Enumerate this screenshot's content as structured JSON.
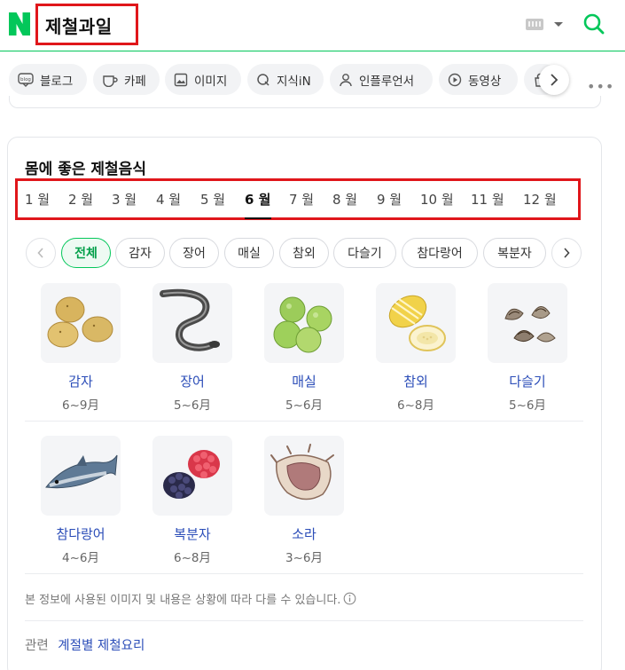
{
  "header": {
    "logo_letter": "N",
    "query": "제철과일",
    "keyboard_icon": "keyboard-icon",
    "search_icon": "search-icon",
    "brand_color": "#03c75a"
  },
  "tabs": [
    {
      "label": "블로그",
      "icon": "blog-icon"
    },
    {
      "label": "카페",
      "icon": "cafe-cup-icon"
    },
    {
      "label": "이미지",
      "icon": "image-icon"
    },
    {
      "label": "지식iN",
      "icon": "kin-icon"
    },
    {
      "label": "인플루언서",
      "icon": "person-icon"
    },
    {
      "label": "동영상",
      "icon": "play-icon"
    },
    {
      "label": "",
      "icon": "shopping-bag-icon"
    }
  ],
  "card": {
    "title": "몸에 좋은 제철음식",
    "months": [
      "1 월",
      "2 월",
      "3 월",
      "4 월",
      "5 월",
      "6 월",
      "7 월",
      "8 월",
      "9 월",
      "10 월",
      "11 월",
      "12 월"
    ],
    "selected_month": "6 월",
    "chips": [
      "전체",
      "감자",
      "장어",
      "매실",
      "참외",
      "다슬기",
      "참다랑어",
      "복분자"
    ],
    "selected_chip": "전체",
    "items": [
      {
        "name": "감자",
        "period": "6~9月",
        "icon": "potato-icon"
      },
      {
        "name": "장어",
        "period": "5~6月",
        "icon": "eel-icon"
      },
      {
        "name": "매실",
        "period": "5~6月",
        "icon": "green-plum-icon"
      },
      {
        "name": "참외",
        "period": "6~8月",
        "icon": "korean-melon-icon"
      },
      {
        "name": "다슬기",
        "period": "5~6月",
        "icon": "freshwater-snail-icon"
      },
      {
        "name": "참다랑어",
        "period": "4~6月",
        "icon": "tuna-icon"
      },
      {
        "name": "복분자",
        "period": "6~8月",
        "icon": "raspberry-icon"
      },
      {
        "name": "소라",
        "period": "3~6月",
        "icon": "conch-icon"
      }
    ],
    "notice": "본 정보에 사용된 이미지 및 내용은 상황에 따라 다를 수 있습니다.",
    "related_label": "관련",
    "related_links": [
      "계절별 제철요리"
    ],
    "link_color": "#2b4db8",
    "highlight_color": "#e0161b"
  }
}
